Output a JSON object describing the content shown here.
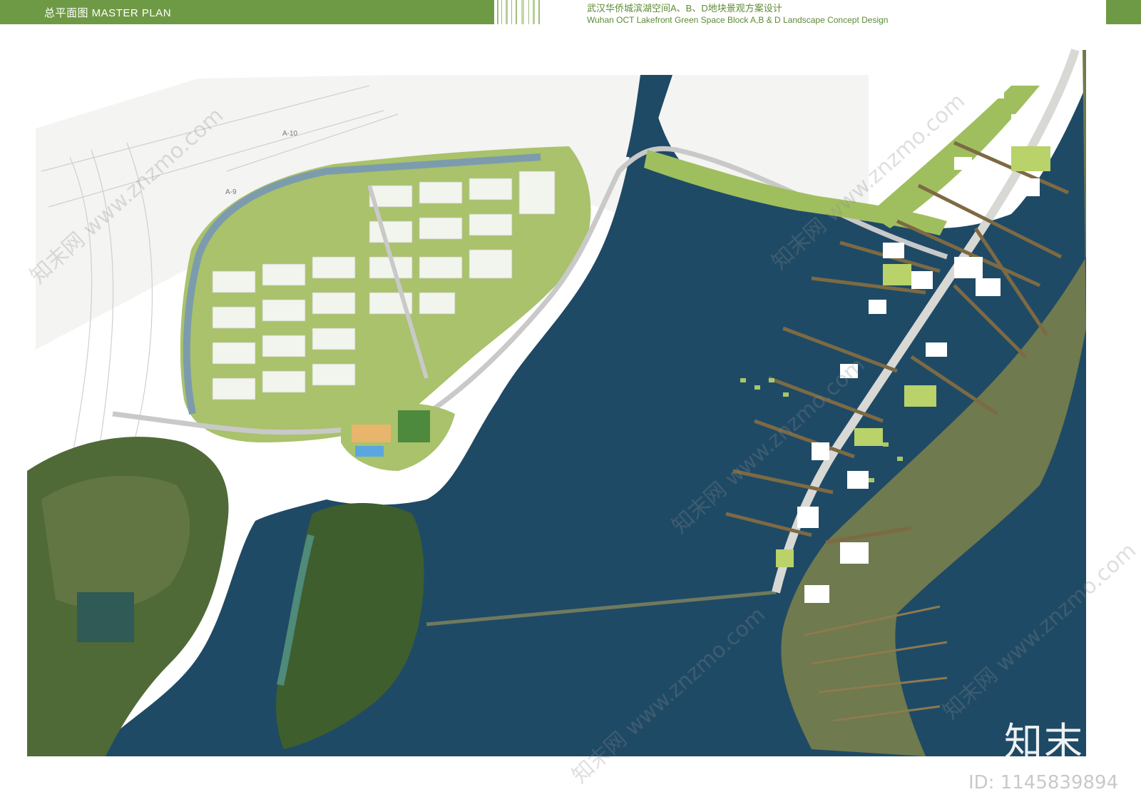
{
  "header": {
    "title": "总平面图 MASTER PLAN"
  },
  "project": {
    "title_cn": "武汉华侨城滨湖空间A、B、D地块景观方案设计",
    "title_en": "Wuhan OCT Lakefront Green Space Block A,B & D Landscape Concept Design"
  },
  "plan": {
    "road_labels": [
      "A-10",
      "A-9"
    ]
  },
  "watermark": {
    "logo_text": "知末",
    "id_text": "ID: 1145839894",
    "site_text": "知末网 www.znzmo.com"
  },
  "colors": {
    "header_green": "#6f9a45",
    "lake": "#1f4a66",
    "park_green": "#a9c26b",
    "forest": "#4f6a36",
    "building": "#f2f4ee"
  }
}
